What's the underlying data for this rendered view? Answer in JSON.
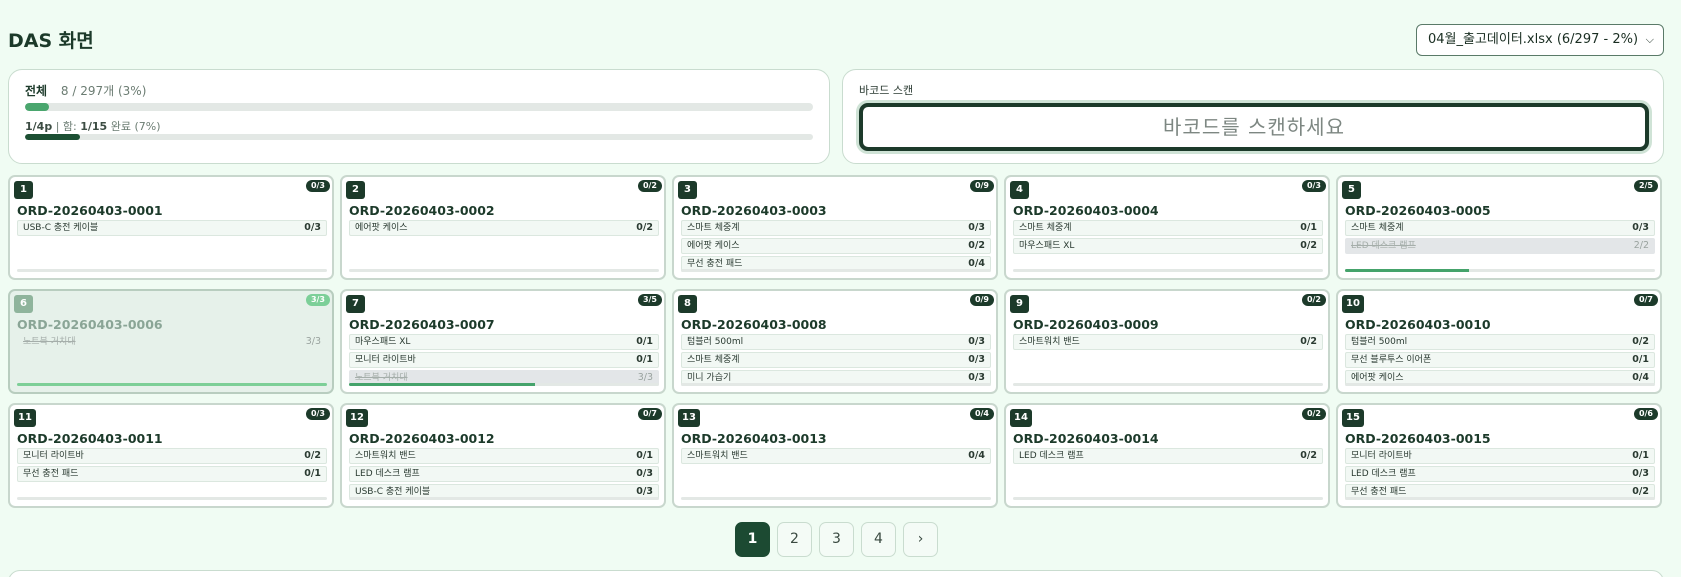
{
  "header": {
    "title": "DAS 화면",
    "file_select": "04월_출고데이터.xlsx (6/297 - 2%)",
    "file_chevron": "chevron-down-icon"
  },
  "progress": {
    "label": "전체",
    "count": "8 / 297개 (3%)",
    "overall_percent": 3,
    "page_prefix": "1/4p",
    "page_mid": " | 함: ",
    "page_boxes": "1/15",
    "page_suffix": " 완료 (7%)",
    "page_percent": 7
  },
  "scan": {
    "label": "바코드 스캔",
    "placeholder": "바코드를 스캔하세요"
  },
  "cards": [
    {
      "num": "1",
      "count": "0/3",
      "order": "ORD-20260403-0001",
      "done": false,
      "progress": 0,
      "items": [
        {
          "name": "USB-C 충전 케이블",
          "qty": "0/3",
          "complete": false
        }
      ]
    },
    {
      "num": "2",
      "count": "0/2",
      "order": "ORD-20260403-0002",
      "done": false,
      "progress": 0,
      "items": [
        {
          "name": "에어팟 케이스",
          "qty": "0/2",
          "complete": false
        }
      ]
    },
    {
      "num": "3",
      "count": "0/9",
      "order": "ORD-20260403-0003",
      "done": false,
      "progress": 0,
      "items": [
        {
          "name": "스마트 체중계",
          "qty": "0/3",
          "complete": false
        },
        {
          "name": "에어팟 케이스",
          "qty": "0/2",
          "complete": false
        },
        {
          "name": "무선 충전 패드",
          "qty": "0/4",
          "complete": false
        }
      ]
    },
    {
      "num": "4",
      "count": "0/3",
      "order": "ORD-20260403-0004",
      "done": false,
      "progress": 0,
      "items": [
        {
          "name": "스마트 체중계",
          "qty": "0/1",
          "complete": false
        },
        {
          "name": "마우스패드 XL",
          "qty": "0/2",
          "complete": false
        }
      ]
    },
    {
      "num": "5",
      "count": "2/5",
      "order": "ORD-20260403-0005",
      "done": false,
      "progress": 40,
      "items": [
        {
          "name": "스마트 체중계",
          "qty": "0/3",
          "complete": false
        },
        {
          "name": "LED 데스크 램프",
          "qty": "2/2",
          "complete": true
        }
      ]
    },
    {
      "num": "6",
      "count": "3/3",
      "order": "ORD-20260403-0006",
      "done": true,
      "progress": 100,
      "items": [
        {
          "name": "노트북 거치대",
          "qty": "3/3",
          "complete": true
        }
      ]
    },
    {
      "num": "7",
      "count": "3/5",
      "order": "ORD-20260403-0007",
      "done": false,
      "progress": 60,
      "items": [
        {
          "name": "마우스패드 XL",
          "qty": "0/1",
          "complete": false
        },
        {
          "name": "모니터 라이트바",
          "qty": "0/1",
          "complete": false
        },
        {
          "name": "노트북 거치대",
          "qty": "3/3",
          "complete": true
        }
      ]
    },
    {
      "num": "8",
      "count": "0/9",
      "order": "ORD-20260403-0008",
      "done": false,
      "progress": 0,
      "items": [
        {
          "name": "텀블러 500ml",
          "qty": "0/3",
          "complete": false
        },
        {
          "name": "스마트 체중계",
          "qty": "0/3",
          "complete": false
        },
        {
          "name": "미니 가습기",
          "qty": "0/3",
          "complete": false
        }
      ]
    },
    {
      "num": "9",
      "count": "0/2",
      "order": "ORD-20260403-0009",
      "done": false,
      "progress": 0,
      "items": [
        {
          "name": "스마트워치 밴드",
          "qty": "0/2",
          "complete": false
        }
      ]
    },
    {
      "num": "10",
      "count": "0/7",
      "order": "ORD-20260403-0010",
      "done": false,
      "progress": 0,
      "items": [
        {
          "name": "텀블러 500ml",
          "qty": "0/2",
          "complete": false
        },
        {
          "name": "무선 블루투스 이어폰",
          "qty": "0/1",
          "complete": false
        },
        {
          "name": "에어팟 케이스",
          "qty": "0/4",
          "complete": false
        }
      ]
    },
    {
      "num": "11",
      "count": "0/3",
      "order": "ORD-20260403-0011",
      "done": false,
      "progress": 0,
      "items": [
        {
          "name": "모니터 라이트바",
          "qty": "0/2",
          "complete": false
        },
        {
          "name": "무선 충전 패드",
          "qty": "0/1",
          "complete": false
        }
      ]
    },
    {
      "num": "12",
      "count": "0/7",
      "order": "ORD-20260403-0012",
      "done": false,
      "progress": 0,
      "items": [
        {
          "name": "스마트워치 밴드",
          "qty": "0/1",
          "complete": false
        },
        {
          "name": "LED 데스크 램프",
          "qty": "0/3",
          "complete": false
        },
        {
          "name": "USB-C 충전 케이블",
          "qty": "0/3",
          "complete": false
        }
      ]
    },
    {
      "num": "13",
      "count": "0/4",
      "order": "ORD-20260403-0013",
      "done": false,
      "progress": 0,
      "items": [
        {
          "name": "스마트워치 밴드",
          "qty": "0/4",
          "complete": false
        }
      ]
    },
    {
      "num": "14",
      "count": "0/2",
      "order": "ORD-20260403-0014",
      "done": false,
      "progress": 0,
      "items": [
        {
          "name": "LED 데스크 램프",
          "qty": "0/2",
          "complete": false
        }
      ]
    },
    {
      "num": "15",
      "count": "0/6",
      "order": "ORD-20260403-0015",
      "done": false,
      "progress": 0,
      "items": [
        {
          "name": "모니터 라이트바",
          "qty": "0/1",
          "complete": false
        },
        {
          "name": "LED 데스크 램프",
          "qty": "0/3",
          "complete": false
        },
        {
          "name": "무선 충전 패드",
          "qty": "0/2",
          "complete": false
        }
      ]
    }
  ],
  "pagination": {
    "pages": [
      "1",
      "2",
      "3",
      "4"
    ],
    "active": "1",
    "next": "›"
  }
}
